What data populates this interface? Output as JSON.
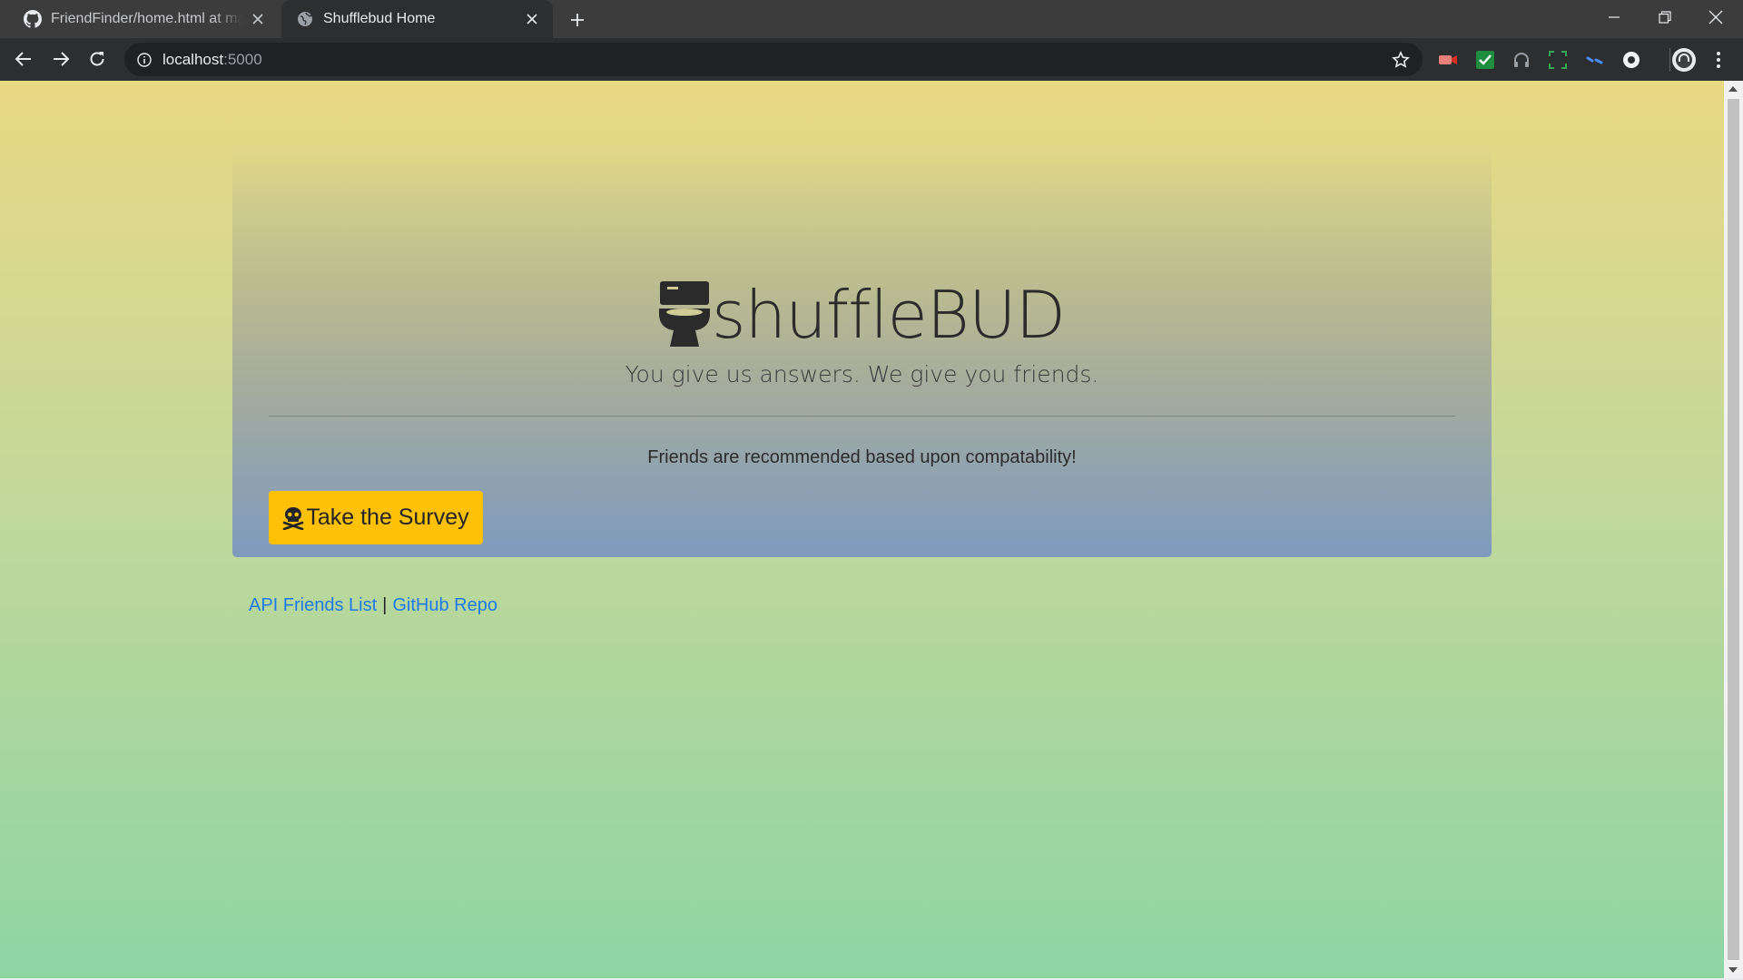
{
  "browser": {
    "tabs": [
      {
        "title": "FriendFinder/home.html at master · ",
        "icon": "github-icon",
        "active": false
      },
      {
        "title": "Shufflebud Home",
        "icon": "globe-icon",
        "active": true
      }
    ],
    "address": {
      "host": "localhost",
      "port": ":5000"
    },
    "extensions": [
      "video-recorder-icon",
      "checkmark-extension-icon",
      "headphones-extension-icon",
      "screenshot-extension-icon",
      "link-extension-icon",
      "circle-extension-icon"
    ]
  },
  "page": {
    "brand": {
      "icon": "toilet-icon",
      "name": "shuffleBUD"
    },
    "tagline": "You give us answers. We give you friends.",
    "lead": "Friends are recommended based upon compatability!",
    "survey_button": {
      "icon": "skull-crossbones-icon",
      "label": "Take the Survey"
    },
    "footer": {
      "links": [
        "API Friends List",
        "GitHub Repo"
      ],
      "separator": "|"
    }
  },
  "colors": {
    "button_warning": "#ffc107",
    "link": "#1f7ae8",
    "gradient_top": "#e9d884",
    "gradient_bottom": "#8ed5a4"
  }
}
